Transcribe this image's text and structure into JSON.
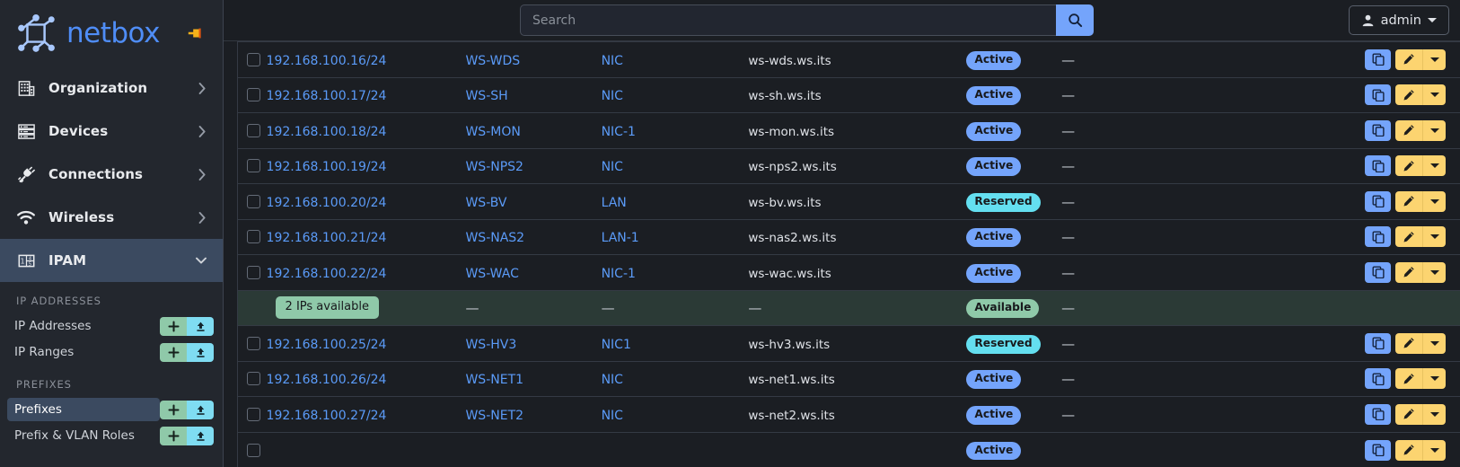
{
  "brand": {
    "name": "netbox",
    "logo_icon": "netbox-logo-icon",
    "pin_icon": "pin-icon"
  },
  "colors": {
    "accent_blue": "#74a4fb",
    "link_blue": "#5b9bf8",
    "status_active": "#74a4fb",
    "status_reserved": "#64dff0",
    "status_available": "#8fc9a9",
    "edit_yellow": "#fcd470",
    "sidebar_bg": "#23272e",
    "main_bg": "#1b1e23",
    "active_nav": "#3b4a60",
    "available_row_bg": "#2b3a36"
  },
  "search": {
    "placeholder": "Search",
    "value": "",
    "icon": "search-icon",
    "button_label": ""
  },
  "user": {
    "label": "admin",
    "icon": "user-icon",
    "caret_icon": "caret-down-icon"
  },
  "sidebar": {
    "nav": [
      {
        "label": "Organization",
        "icon": "building-icon",
        "chevron": "chevron-right-icon",
        "active": false
      },
      {
        "label": "Devices",
        "icon": "server-icon",
        "chevron": "chevron-right-icon",
        "active": false
      },
      {
        "label": "Connections",
        "icon": "plug-icon",
        "chevron": "chevron-right-icon",
        "active": false
      },
      {
        "label": "Wireless",
        "icon": "wifi-icon",
        "chevron": "chevron-right-icon",
        "active": false
      },
      {
        "label": "IPAM",
        "icon": "ipam-icon",
        "chevron": "chevron-down-icon",
        "active": true
      }
    ],
    "groups": [
      {
        "title": "IP ADDRESSES",
        "items": [
          {
            "label": "IP Addresses",
            "selected": false,
            "add_icon": "plus-icon",
            "import_icon": "upload-icon"
          },
          {
            "label": "IP Ranges",
            "selected": false,
            "add_icon": "plus-icon",
            "import_icon": "upload-icon"
          }
        ]
      },
      {
        "title": "PREFIXES",
        "items": [
          {
            "label": "Prefixes",
            "selected": true,
            "add_icon": "plus-icon",
            "import_icon": "upload-icon"
          },
          {
            "label": "Prefix & VLAN Roles",
            "selected": false,
            "add_icon": "plus-icon",
            "import_icon": "upload-icon"
          }
        ]
      }
    ]
  },
  "table": {
    "row_actions": {
      "clone_icon": "copy-icon",
      "edit_icon": "pencil-icon",
      "caret_icon": "caret-down-icon"
    },
    "rows": [
      {
        "type": "ip",
        "address": "192.168.100.16/24",
        "device": "WS-WDS",
        "interface": "NIC",
        "dns_name": "ws-wds.ws.its",
        "status": "Active",
        "status_class": "active",
        "tags": "—"
      },
      {
        "type": "ip",
        "address": "192.168.100.17/24",
        "device": "WS-SH",
        "interface": "NIC",
        "dns_name": "ws-sh.ws.its",
        "status": "Active",
        "status_class": "active",
        "tags": "—"
      },
      {
        "type": "ip",
        "address": "192.168.100.18/24",
        "device": "WS-MON",
        "interface": "NIC-1",
        "dns_name": "ws-mon.ws.its",
        "status": "Active",
        "status_class": "active",
        "tags": "—"
      },
      {
        "type": "ip",
        "address": "192.168.100.19/24",
        "device": "WS-NPS2",
        "interface": "NIC",
        "dns_name": "ws-nps2.ws.its",
        "status": "Active",
        "status_class": "active",
        "tags": "—"
      },
      {
        "type": "ip",
        "address": "192.168.100.20/24",
        "device": "WS-BV",
        "interface": "LAN",
        "dns_name": "ws-bv.ws.its",
        "status": "Reserved",
        "status_class": "reserved",
        "tags": "—"
      },
      {
        "type": "ip",
        "address": "192.168.100.21/24",
        "device": "WS-NAS2",
        "interface": "LAN-1",
        "dns_name": "ws-nas2.ws.its",
        "status": "Active",
        "status_class": "active",
        "tags": "—"
      },
      {
        "type": "ip",
        "address": "192.168.100.22/24",
        "device": "WS-WAC",
        "interface": "NIC-1",
        "dns_name": "ws-wac.ws.its",
        "status": "Active",
        "status_class": "active",
        "tags": "—"
      },
      {
        "type": "available",
        "address": "2 IPs available",
        "device": "—",
        "interface": "—",
        "dns_name": "—",
        "status": "Available",
        "status_class": "available",
        "tags": "—"
      },
      {
        "type": "ip",
        "address": "192.168.100.25/24",
        "device": "WS-HV3",
        "interface": "NIC1",
        "dns_name": "ws-hv3.ws.its",
        "status": "Reserved",
        "status_class": "reserved",
        "tags": "—"
      },
      {
        "type": "ip",
        "address": "192.168.100.26/24",
        "device": "WS-NET1",
        "interface": "NIC",
        "dns_name": "ws-net1.ws.its",
        "status": "Active",
        "status_class": "active",
        "tags": "—"
      },
      {
        "type": "ip",
        "address": "192.168.100.27/24",
        "device": "WS-NET2",
        "interface": "NIC",
        "dns_name": "ws-net2.ws.its",
        "status": "Active",
        "status_class": "active",
        "tags": "—"
      },
      {
        "type": "ip",
        "address": "",
        "device": "",
        "interface": "",
        "dns_name": "",
        "status": "Active",
        "status_class": "active",
        "tags": ""
      }
    ]
  }
}
